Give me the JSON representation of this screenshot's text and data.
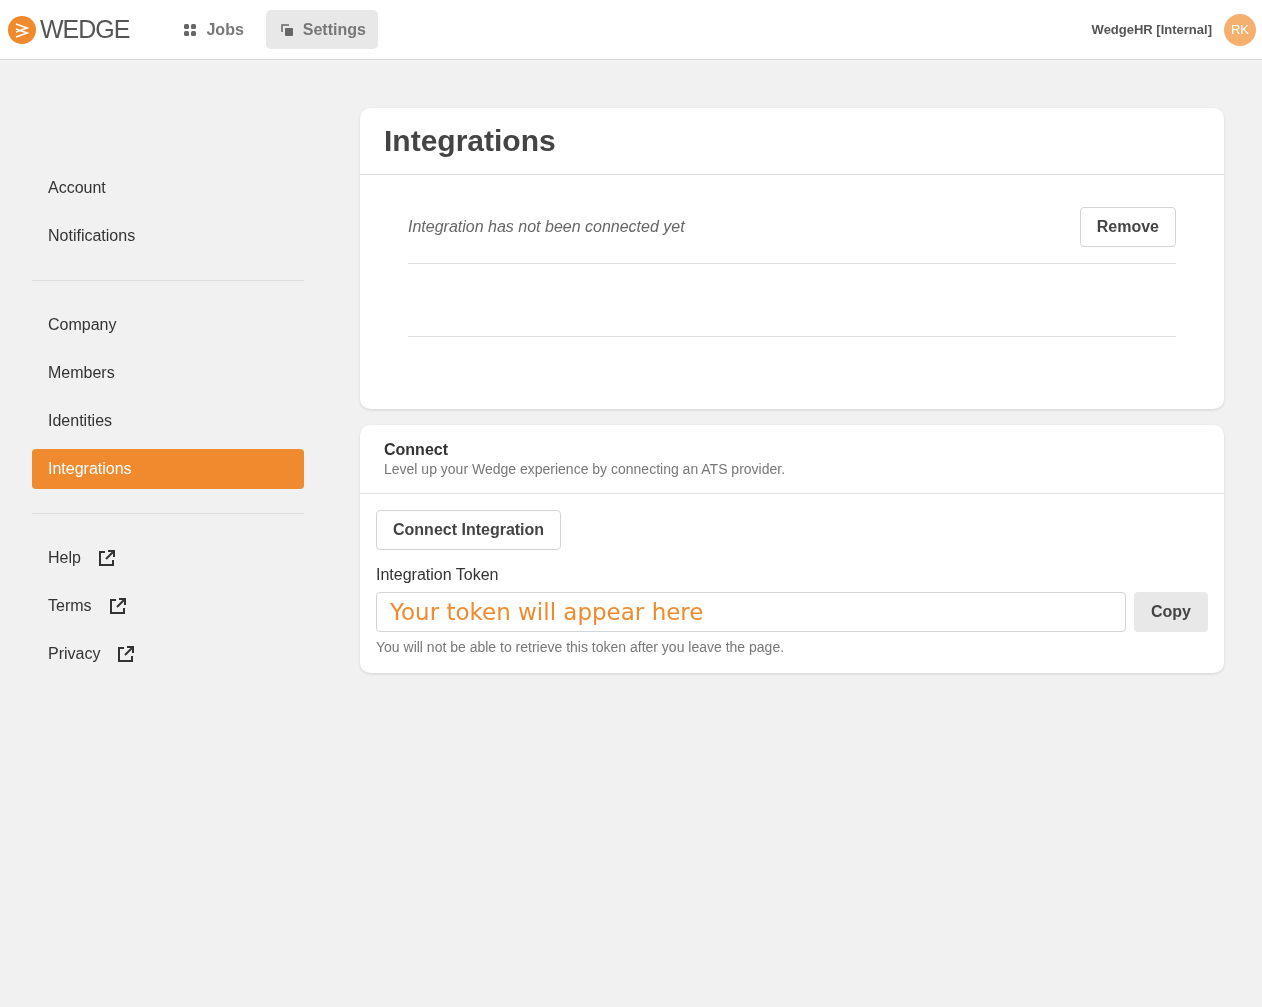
{
  "header": {
    "logo": "WEDGE",
    "tabs": [
      {
        "label": "Jobs",
        "kind": "grid",
        "selected": false
      },
      {
        "label": "Settings",
        "kind": "copy",
        "selected": true
      }
    ],
    "org": "WedgeHR [Internal]",
    "avatar": "RK"
  },
  "sidebar": {
    "groups": [
      [
        {
          "label": "Account",
          "selected": false,
          "external": false
        },
        {
          "label": "Notifications",
          "selected": false,
          "external": false
        }
      ],
      [
        {
          "label": "Company",
          "selected": false,
          "external": false
        },
        {
          "label": "Members",
          "selected": false,
          "external": false
        },
        {
          "label": "Identities",
          "selected": false,
          "external": false
        },
        {
          "label": "Integrations",
          "selected": true,
          "external": false
        }
      ],
      [
        {
          "label": "Help",
          "selected": false,
          "external": true
        },
        {
          "label": "Terms",
          "selected": false,
          "external": true
        },
        {
          "label": "Privacy",
          "selected": false,
          "external": true
        }
      ]
    ]
  },
  "integrations": {
    "title": "Integrations",
    "status": "Integration has not been connected yet",
    "remove_button": "Remove"
  },
  "connect": {
    "title": "Connect",
    "subtitle": "Level up your Wedge experience by connecting an ATS provider.",
    "connect_button": "Connect Integration",
    "token_label": "Integration Token",
    "token_placeholder": "Your token will appear here",
    "copy_button": "Copy",
    "note": "You will not be able to retrieve this token after you leave the page."
  }
}
